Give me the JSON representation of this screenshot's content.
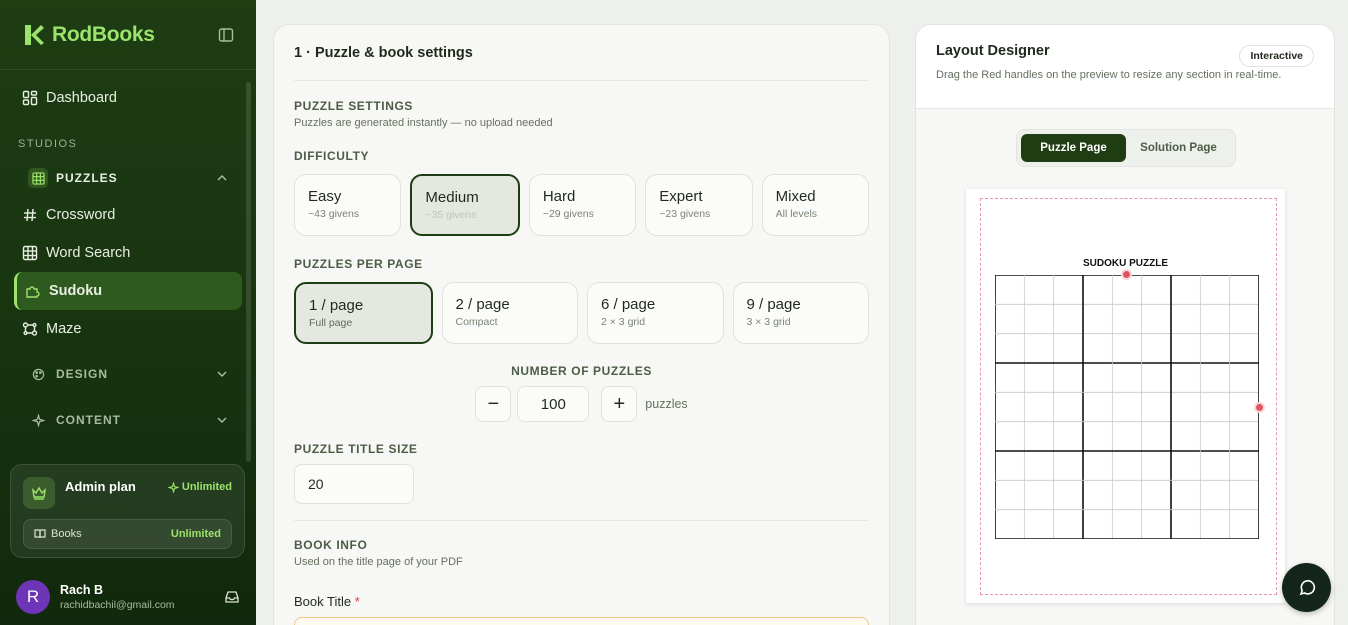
{
  "app": {
    "logo_text": "RodBooks",
    "accent": "#9be36b",
    "sidebar_bg": "#173410"
  },
  "sidebar": {
    "dashboard": "Dashboard",
    "section_label": "STUDIOS",
    "groups": {
      "puzzles": "PUZZLES",
      "design": "DESIGN",
      "content": "CONTENT"
    },
    "puzzle_items": {
      "crossword": "Crossword",
      "word_search": "Word Search",
      "sudoku": "Sudoku",
      "maze": "Maze"
    },
    "plan": {
      "name": "Admin plan",
      "badge": "Unlimited",
      "books_label": "Books",
      "books_value": "Unlimited"
    },
    "user": {
      "initial": "R",
      "name": "Rach B",
      "email": "rachidbachil@gmail.com"
    }
  },
  "settings": {
    "title": "1 · Puzzle & book settings",
    "puzzle_settings": {
      "label": "PUZZLE SETTINGS",
      "sub": "Puzzles are generated instantly — no upload needed"
    },
    "difficulty": {
      "label": "DIFFICULTY",
      "options": [
        {
          "title": "Easy",
          "sub": "~43 givens"
        },
        {
          "title": "Medium",
          "sub": "~35 givens"
        },
        {
          "title": "Hard",
          "sub": "~29 givens"
        },
        {
          "title": "Expert",
          "sub": "~23 givens"
        },
        {
          "title": "Mixed",
          "sub": "All levels"
        }
      ],
      "selected": "Medium"
    },
    "per_page": {
      "label": "PUZZLES PER PAGE",
      "options": [
        {
          "title": "1 / page",
          "sub": "Full page"
        },
        {
          "title": "2 / page",
          "sub": "Compact"
        },
        {
          "title": "6 / page",
          "sub": "2 × 3 grid"
        },
        {
          "title": "9 / page",
          "sub": "3 × 3 grid"
        }
      ],
      "selected": "1 / page"
    },
    "count": {
      "label": "NUMBER OF PUZZLES",
      "minus": "−",
      "value": "100",
      "plus": "+",
      "unit": "puzzles"
    },
    "title_size": {
      "label": "PUZZLE TITLE SIZE",
      "value": "20"
    },
    "book_info": {
      "label": "BOOK INFO",
      "sub": "Used on the title page of your PDF",
      "book_title_label": "Book Title",
      "required_mark": "*"
    }
  },
  "layout_designer": {
    "title": "Layout Designer",
    "badge": "Interactive",
    "sub": "Drag the Red handles on the preview to resize any section in real-time.",
    "tabs": [
      "Puzzle Page",
      "Solution Page"
    ],
    "active_tab": "Puzzle Page",
    "preview": {
      "puzzle_title": "SUDOKU PUZZLE",
      "grid_size": 9,
      "box_size": 3
    }
  }
}
